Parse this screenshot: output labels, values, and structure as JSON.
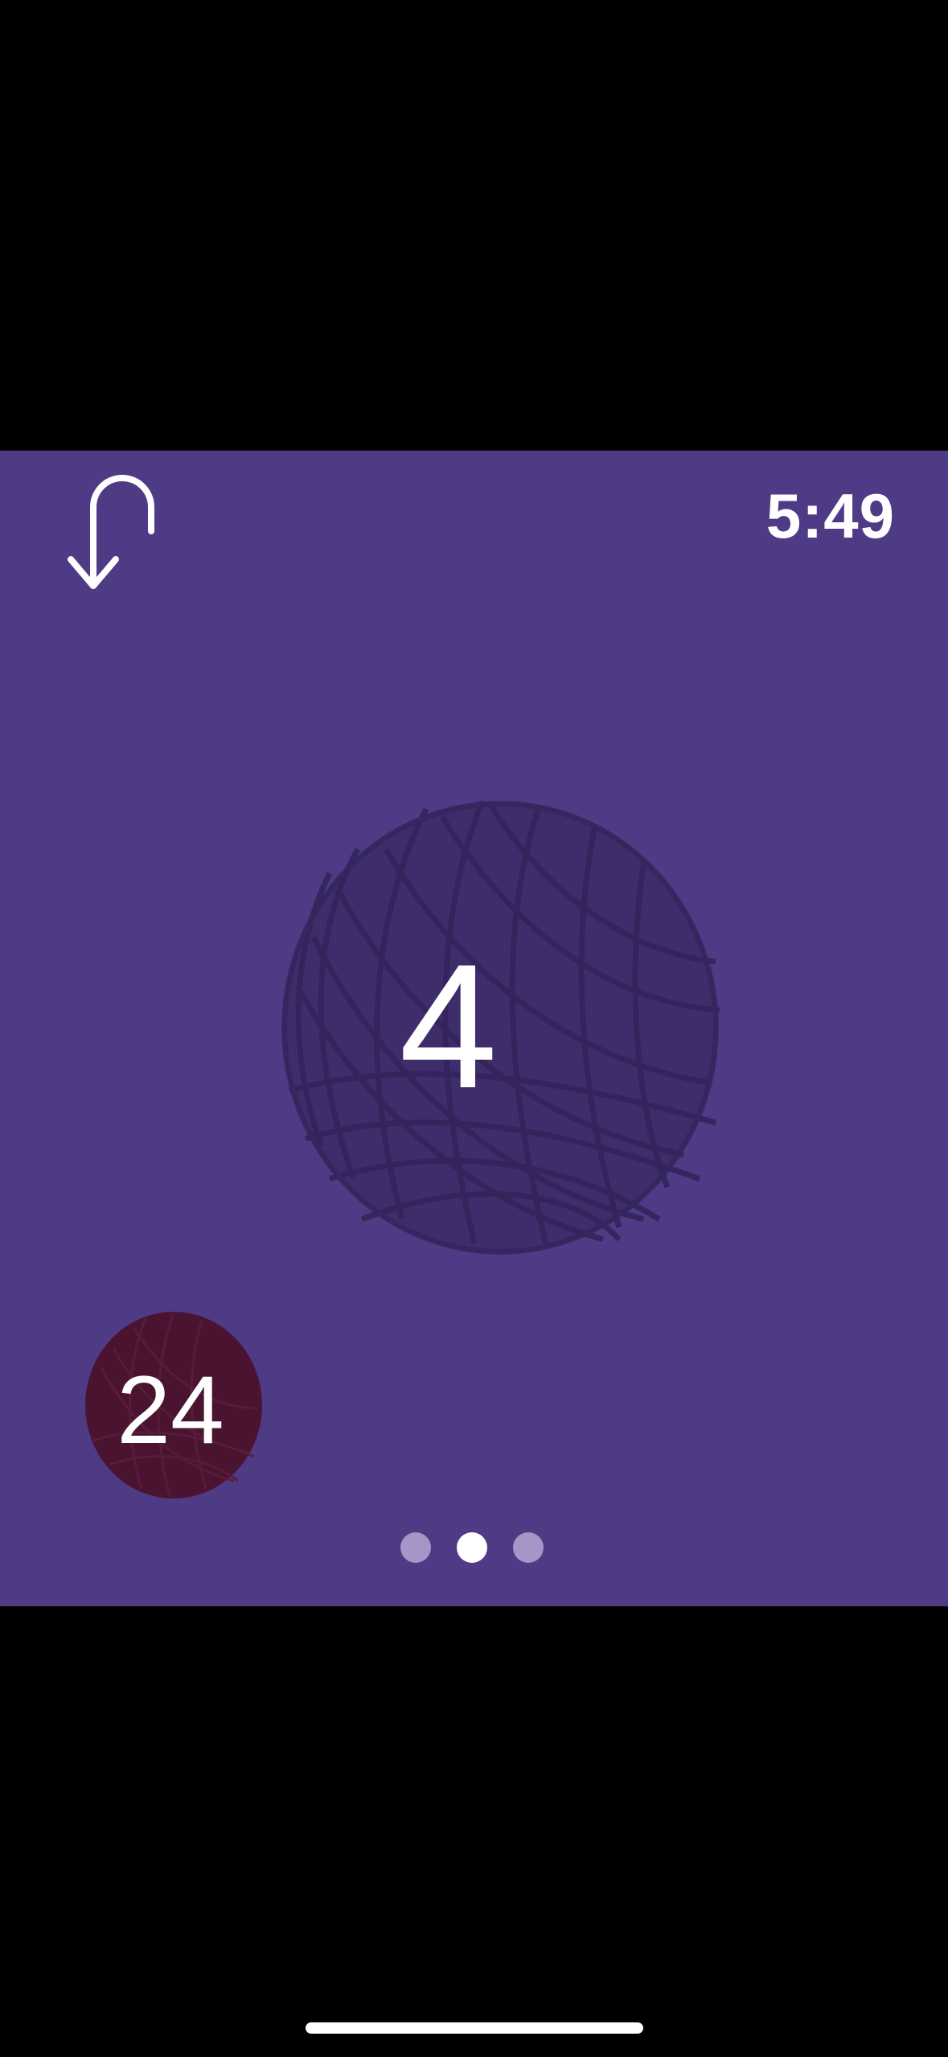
{
  "status": {
    "time": "5:49"
  },
  "toolbar": {
    "undo_icon": "undo-arrow-icon"
  },
  "counter": {
    "main_value": "4",
    "secondary_value": "24"
  },
  "pager": {
    "pages": 3,
    "active_index": 1
  },
  "colors": {
    "background": "#4f3a86",
    "main_yarn": "#3e2d6a",
    "secondary_yarn": "#4a1430",
    "dot_inactive": "#a695c7",
    "dot_active": "#ffffff"
  }
}
